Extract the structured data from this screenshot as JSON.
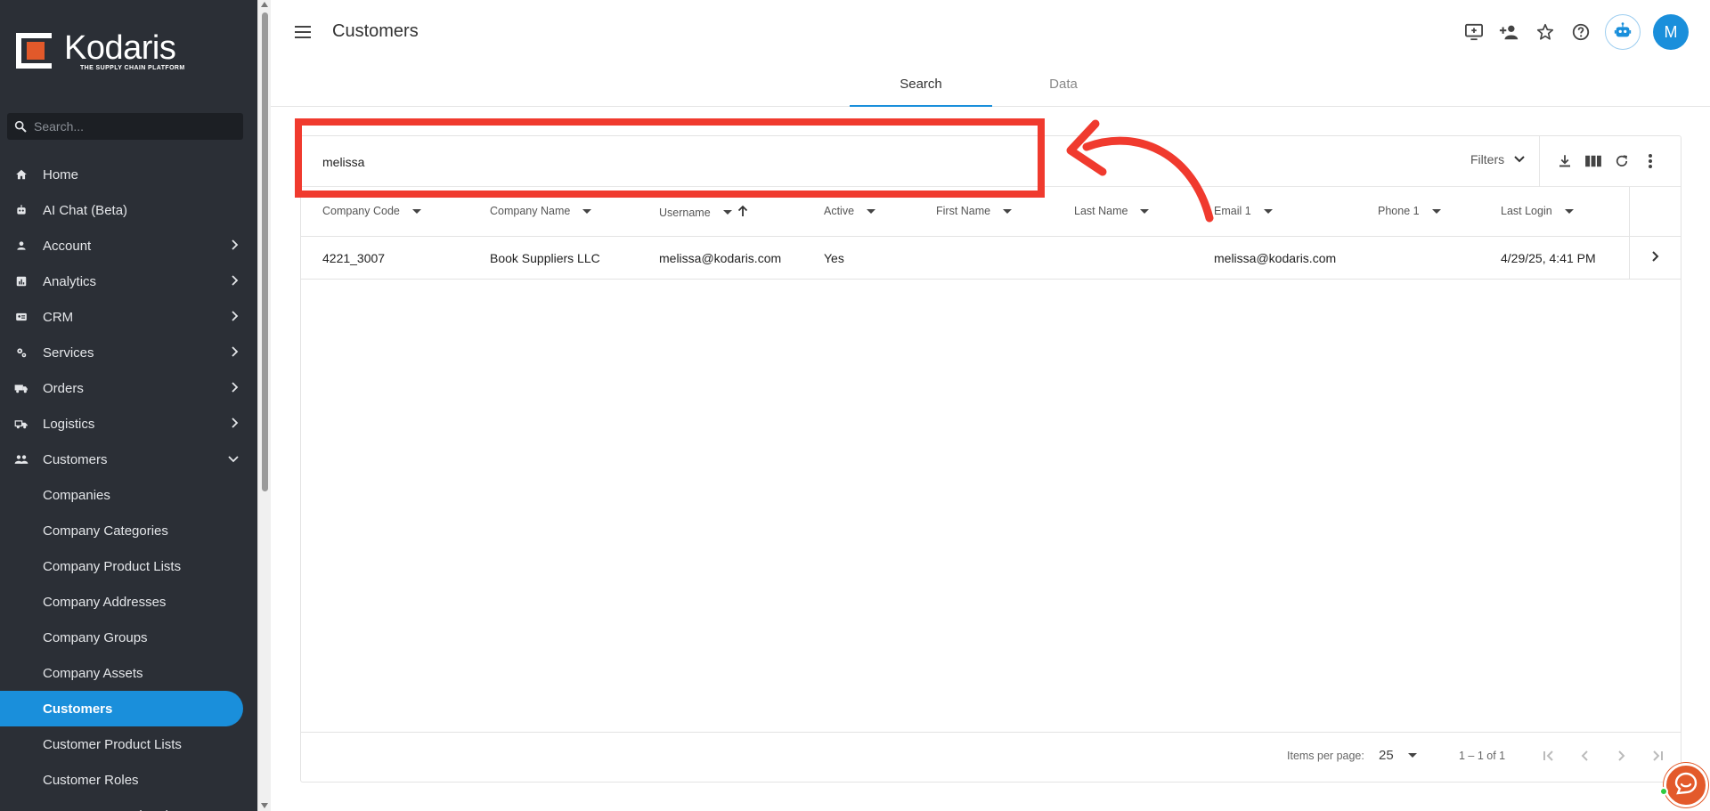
{
  "app": {
    "logo_name": "Kodaris",
    "logo_tagline": "THE SUPPLY CHAIN PLATFORM"
  },
  "sidebar": {
    "search_placeholder": "Search...",
    "items": [
      {
        "label": "Home",
        "icon": "home-icon",
        "expandable": false
      },
      {
        "label": "AI Chat (Beta)",
        "icon": "robot-icon",
        "expandable": false
      },
      {
        "label": "Account",
        "icon": "person-icon",
        "expandable": true
      },
      {
        "label": "Analytics",
        "icon": "chart-icon",
        "expandable": true
      },
      {
        "label": "CRM",
        "icon": "contact-card-icon",
        "expandable": true
      },
      {
        "label": "Services",
        "icon": "gears-icon",
        "expandable": true
      },
      {
        "label": "Orders",
        "icon": "truck-icon",
        "expandable": true
      },
      {
        "label": "Logistics",
        "icon": "shipping-icon",
        "expandable": true
      },
      {
        "label": "Customers",
        "icon": "people-icon",
        "expandable": true,
        "expanded": true
      }
    ],
    "customers_sub": [
      "Companies",
      "Company Categories",
      "Company Product Lists",
      "Company Addresses",
      "Company Groups",
      "Company Assets",
      "Customers",
      "Customer Product Lists",
      "Customer Roles",
      "Customer Saved Ord..."
    ],
    "active_sub": "Customers"
  },
  "header": {
    "title": "Customers",
    "avatar_initial": "M"
  },
  "tabs": [
    {
      "label": "Search",
      "active": true
    },
    {
      "label": "Data",
      "active": false
    }
  ],
  "search": {
    "value": "melissa",
    "filters_label": "Filters"
  },
  "table": {
    "columns": [
      "Company Code",
      "Company Name",
      "Username",
      "Active",
      "First Name",
      "Last Name",
      "Email 1",
      "Phone 1",
      "Last Login"
    ],
    "sorted_column": "Username",
    "rows": [
      {
        "company_code": "4221_3007",
        "company_name": "Book Suppliers LLC",
        "username": "melissa@kodaris.com",
        "active": "Yes",
        "first_name": "",
        "last_name": "",
        "email1": "melissa@kodaris.com",
        "phone1": "",
        "last_login": "4/29/25, 4:41 PM"
      }
    ]
  },
  "paginator": {
    "items_per_page_label": "Items per page:",
    "items_per_page": "25",
    "range": "1 – 1 of 1"
  },
  "colors": {
    "sidebar_bg": "#2b2f36",
    "accent": "#1a8fdb",
    "annotation": "#f03a2e",
    "brand_orange": "#e2592a"
  }
}
